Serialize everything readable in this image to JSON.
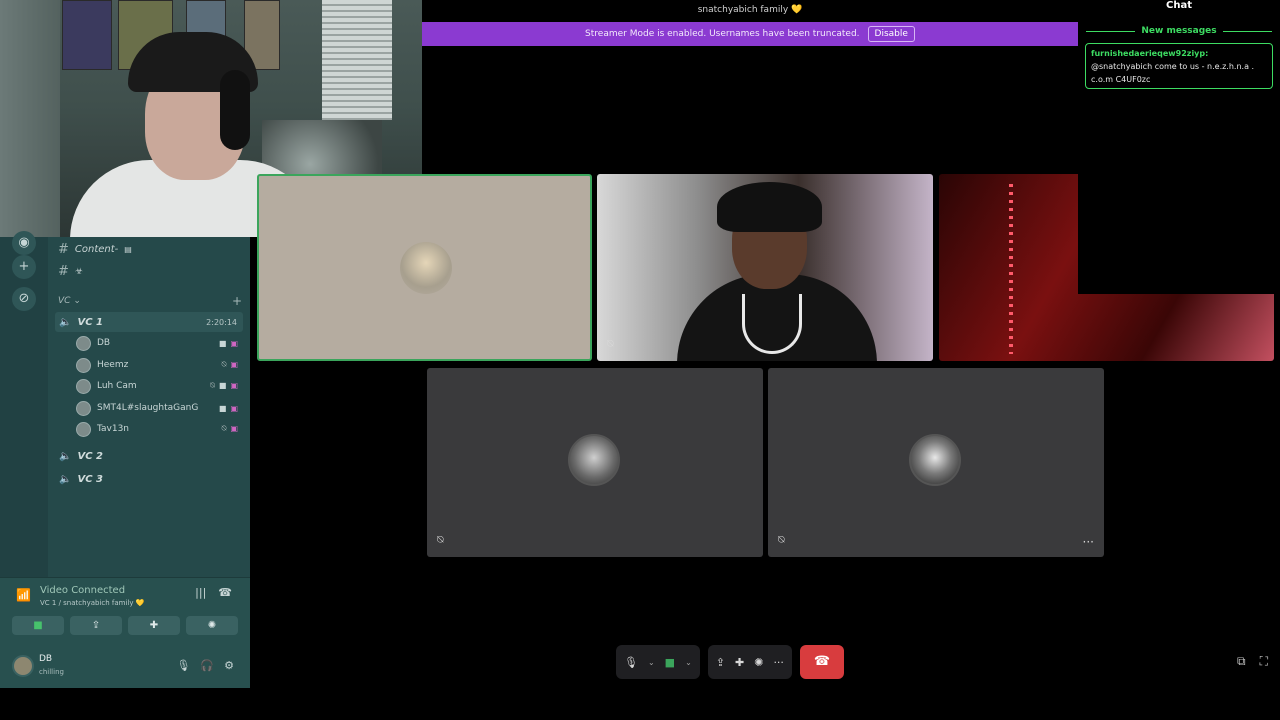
{
  "top_bar": {
    "server_name": "snatchyabich family 💛"
  },
  "banner": {
    "text": "Streamer Mode is enabled. Usernames have been truncated.",
    "button": "Disable"
  },
  "channels": {
    "text": [
      {
        "name": "Content-"
      },
      {
        "name": ""
      }
    ],
    "voice_category": "VC",
    "voice_channels": [
      {
        "name": "VC 1",
        "duration": "2:20:14"
      },
      {
        "name": "VC 2"
      },
      {
        "name": "VC 3"
      }
    ],
    "members": [
      {
        "name": "DB",
        "camera": true,
        "live": true,
        "muted": false
      },
      {
        "name": "Heemz",
        "camera": false,
        "live": true,
        "muted": true
      },
      {
        "name": "Luh Cam",
        "camera": false,
        "live": true,
        "muted": true
      },
      {
        "name": "SMT4L#slaughtaGanG",
        "camera": true,
        "live": true,
        "muted": false
      },
      {
        "name": "Tav13n",
        "camera": false,
        "live": true,
        "muted": true
      }
    ]
  },
  "voice_panel": {
    "status": "Video Connected",
    "sub": "VC 1 / snatchyabich family 💛"
  },
  "user": {
    "name": "DB",
    "status": "chilling"
  },
  "chat": {
    "title": "Chat",
    "new_messages_label": "New messages",
    "message_user": "furnishedaerieqew92ziyp",
    "message_text": "@snatchyabich come to us - n.e.z.h.n.a . c.o.m C4UF0zc"
  },
  "colors": {
    "accent_green": "#3ddc62",
    "streamer_banner": "#8b3ad1",
    "end_call": "#d83c3e",
    "sidebar": "#25494a"
  }
}
